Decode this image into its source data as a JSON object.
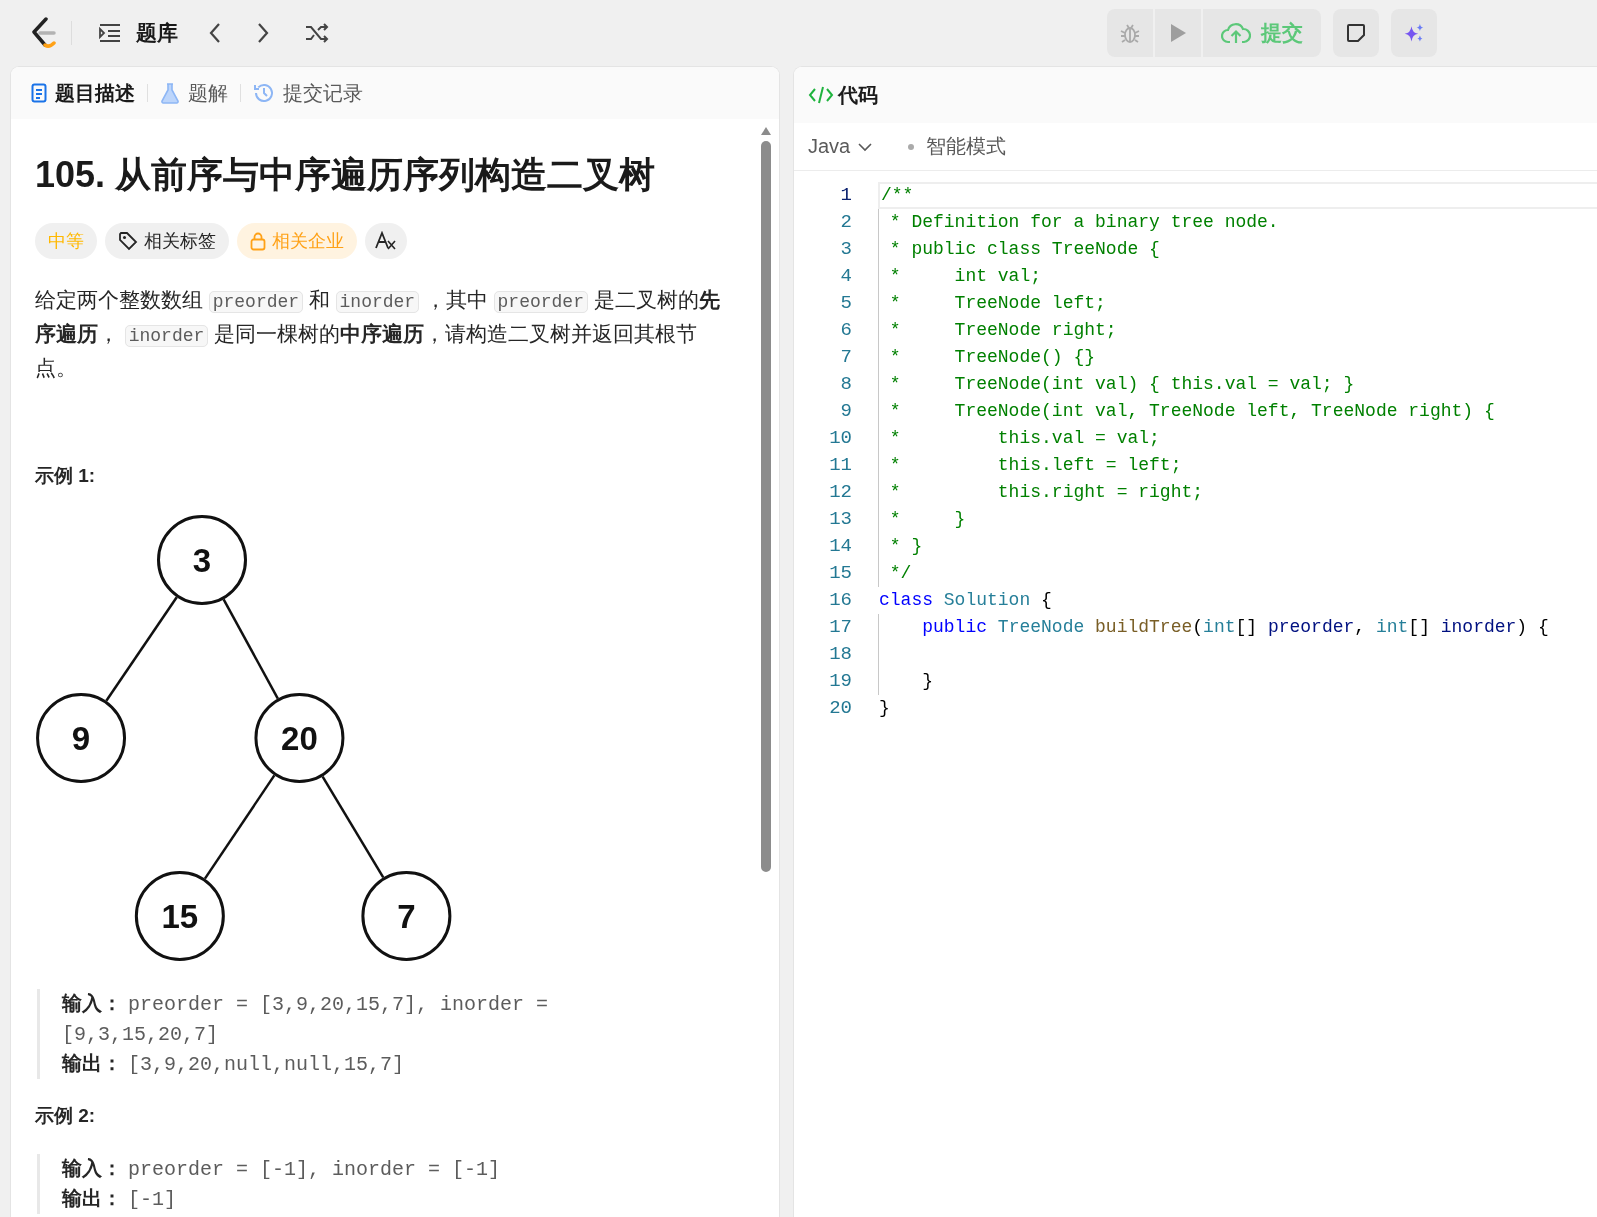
{
  "topbar": {
    "nav_label": "题库",
    "submit_label": "提交"
  },
  "problem_panel": {
    "tabs": [
      {
        "label": "题目描述",
        "selected": true
      },
      {
        "label": "题解",
        "selected": false
      },
      {
        "label": "提交记录",
        "selected": false
      }
    ],
    "title": "105. 从前序与中序遍历序列构造二叉树",
    "tags": [
      {
        "kind": "difficulty",
        "label": "中等"
      },
      {
        "kind": "topics",
        "label": "相关标签"
      },
      {
        "kind": "companies",
        "label": "相关企业"
      },
      {
        "kind": "translate"
      }
    ],
    "description": [
      {
        "kind": "text",
        "text": "给定两个整数数组 "
      },
      {
        "kind": "code",
        "text": "preorder"
      },
      {
        "kind": "text",
        "text": " 和 "
      },
      {
        "kind": "code",
        "text": "inorder"
      },
      {
        "kind": "text",
        "text": " ，其中 "
      },
      {
        "kind": "code",
        "text": "preorder"
      },
      {
        "kind": "text",
        "text": " 是二叉树的**先序遍历**， "
      },
      {
        "kind": "code",
        "text": "inorder"
      },
      {
        "kind": "text",
        "text": " 是同一棵树的**中序遍历**，请构造二叉树并返回其根节点。"
      }
    ],
    "examples": [
      {
        "heading": "示例 1:",
        "tree": {
          "value": "3",
          "children": [
            {
              "value": "9"
            },
            {
              "value": "20",
              "children": [
                {
                  "value": "15"
                },
                {
                  "value": "7"
                }
              ]
            }
          ]
        },
        "lines": [
          {
            "label": "输入：",
            "value": "preorder = [3,9,20,15,7], inorder = [9,3,15,20,7]"
          },
          {
            "label": "输出：",
            "value": "[3,9,20,null,null,15,7]"
          }
        ]
      },
      {
        "heading": "示例 2:",
        "lines": [
          {
            "label": "输入：",
            "value": "preorder = [-1], inorder = [-1]"
          },
          {
            "label": "输出：",
            "value": "[-1]"
          }
        ]
      }
    ]
  },
  "code_panel": {
    "title": "代码",
    "language": "Java",
    "mode": "智能模式",
    "lines": [
      {
        "number": "1",
        "current": true,
        "tokens": [
          {
            "kind": "comment",
            "text": "/**"
          }
        ]
      },
      {
        "number": "2",
        "current": false,
        "tokens": [
          {
            "kind": "comment",
            "text": " * Definition for a binary tree node."
          }
        ]
      },
      {
        "number": "3",
        "current": false,
        "tokens": [
          {
            "kind": "comment",
            "text": " * public class TreeNode {"
          }
        ]
      },
      {
        "number": "4",
        "current": false,
        "tokens": [
          {
            "kind": "comment",
            "text": " *     int val;"
          }
        ]
      },
      {
        "number": "5",
        "current": false,
        "tokens": [
          {
            "kind": "comment",
            "text": " *     TreeNode left;"
          }
        ]
      },
      {
        "number": "6",
        "current": false,
        "tokens": [
          {
            "kind": "comment",
            "text": " *     TreeNode right;"
          }
        ]
      },
      {
        "number": "7",
        "current": false,
        "tokens": [
          {
            "kind": "comment",
            "text": " *     TreeNode() {}"
          }
        ]
      },
      {
        "number": "8",
        "current": false,
        "tokens": [
          {
            "kind": "comment",
            "text": " *     TreeNode(int val) { this.val = val; }"
          }
        ]
      },
      {
        "number": "9",
        "current": false,
        "tokens": [
          {
            "kind": "comment",
            "text": " *     TreeNode(int val, TreeNode left, TreeNode right) {"
          }
        ]
      },
      {
        "number": "10",
        "current": false,
        "tokens": [
          {
            "kind": "comment",
            "text": " *         this.val = val;"
          }
        ]
      },
      {
        "number": "11",
        "current": false,
        "tokens": [
          {
            "kind": "comment",
            "text": " *         this.left = left;"
          }
        ]
      },
      {
        "number": "12",
        "current": false,
        "tokens": [
          {
            "kind": "comment",
            "text": " *         this.right = right;"
          }
        ]
      },
      {
        "number": "13",
        "current": false,
        "tokens": [
          {
            "kind": "comment",
            "text": " *     }"
          }
        ]
      },
      {
        "number": "14",
        "current": false,
        "tokens": [
          {
            "kind": "comment",
            "text": " * }"
          }
        ]
      },
      {
        "number": "15",
        "current": false,
        "tokens": [
          {
            "kind": "comment",
            "text": " */"
          }
        ]
      },
      {
        "number": "16",
        "current": false,
        "tokens": [
          {
            "kind": "keyword",
            "text": "class "
          },
          {
            "kind": "type",
            "text": "Solution "
          },
          {
            "kind": "plain",
            "text": "{"
          }
        ]
      },
      {
        "number": "17",
        "current": false,
        "tokens": [
          {
            "kind": "keyword",
            "text": "    public "
          },
          {
            "kind": "type",
            "text": "TreeNode "
          },
          {
            "kind": "function",
            "text": "buildTree"
          },
          {
            "kind": "plain",
            "text": "("
          },
          {
            "kind": "type",
            "text": "int"
          },
          {
            "kind": "plain",
            "text": "[] "
          },
          {
            "kind": "variable",
            "text": "preorder"
          },
          {
            "kind": "plain",
            "text": ", "
          },
          {
            "kind": "type",
            "text": "int"
          },
          {
            "kind": "plain",
            "text": "[] "
          },
          {
            "kind": "variable",
            "text": "inorder"
          },
          {
            "kind": "plain",
            "text": ") {"
          }
        ]
      },
      {
        "number": "18",
        "current": false
      },
      {
        "number": "19",
        "current": false,
        "tokens": [
          {
            "kind": "plain",
            "text": "    }"
          }
        ]
      },
      {
        "number": "20",
        "current": false,
        "tokens": [
          {
            "kind": "plain",
            "text": "}"
          }
        ]
      }
    ]
  }
}
